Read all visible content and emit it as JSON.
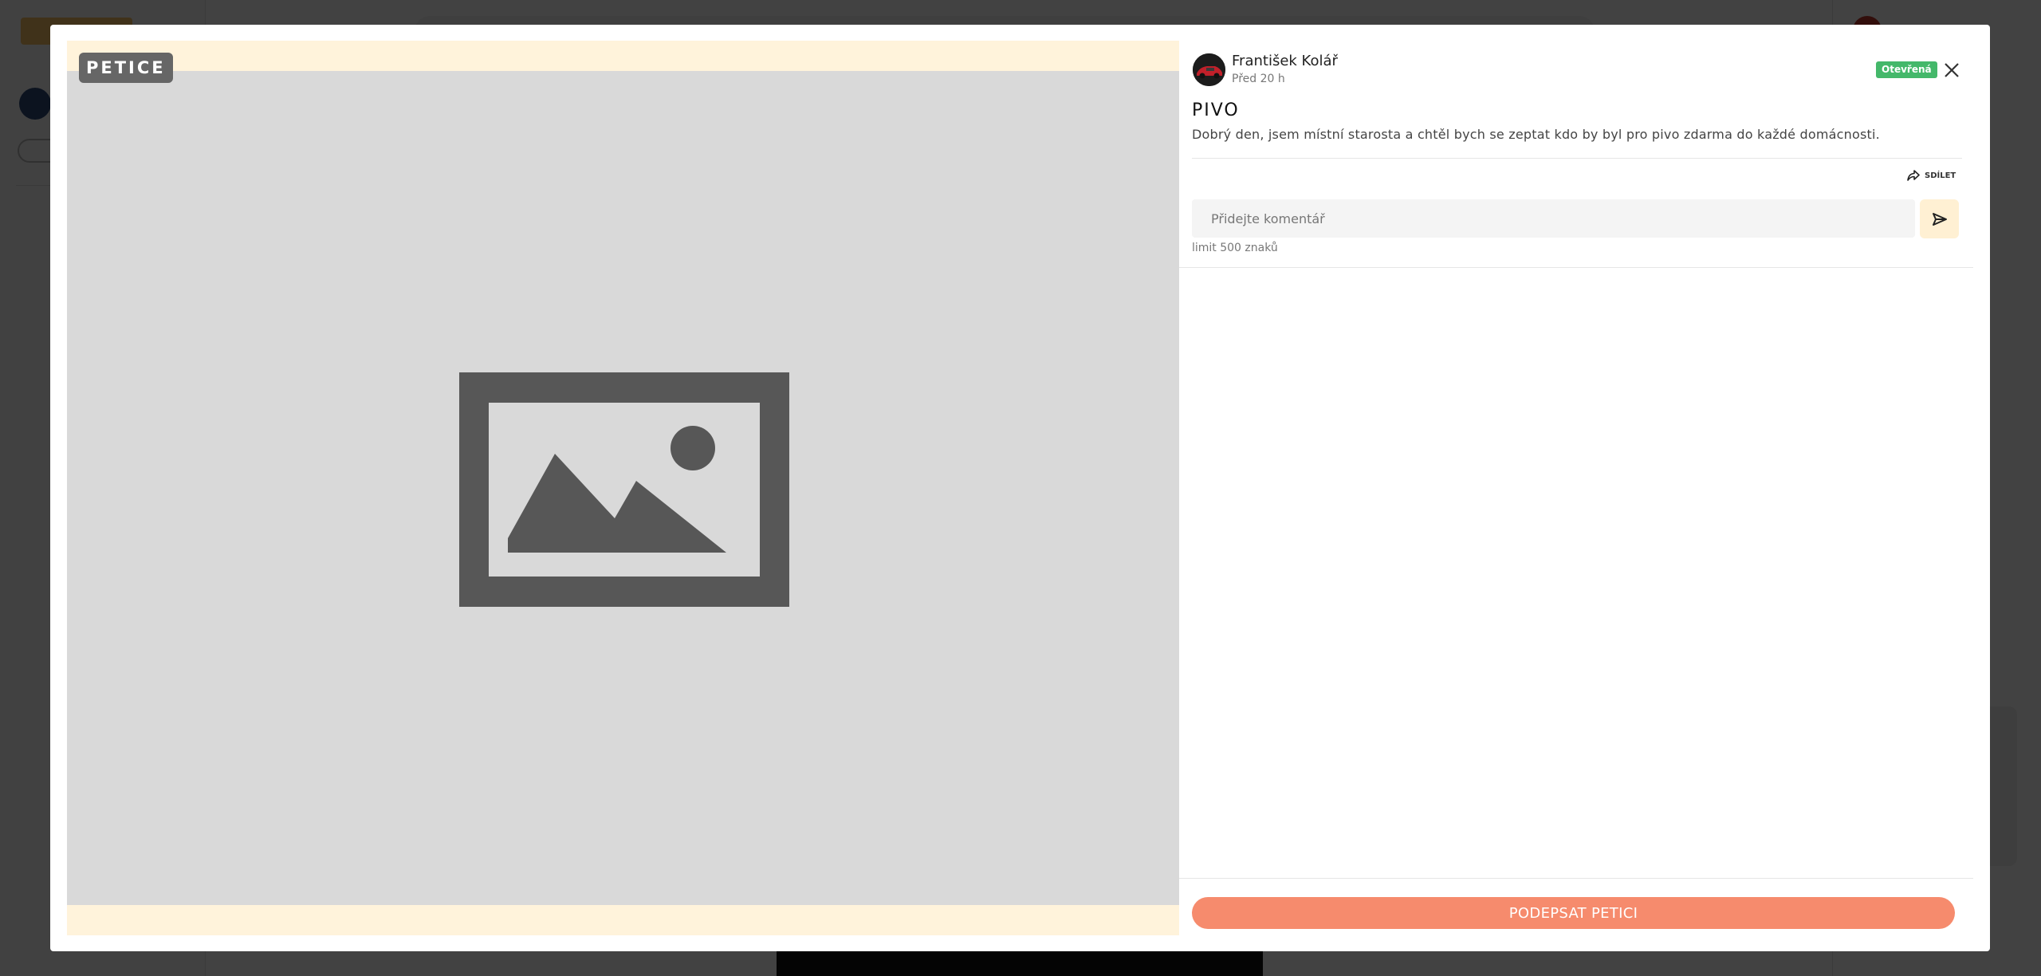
{
  "media": {
    "type_badge": "PETICE",
    "placeholder_icon": "image-placeholder-icon"
  },
  "post": {
    "author": "František Kolář",
    "time": "Před 20 h",
    "status": "Otevřená",
    "title": "PIVO",
    "body": "Dobrý den, jsem místní starosta a chtěl bych se zeptat kdo by byl pro pivo zdarma do každé domácnosti."
  },
  "actions": {
    "share_label": "SDÍLET",
    "close_icon": "close-icon"
  },
  "comment": {
    "placeholder": "Přidejte komentář",
    "limit": "limit 500 znaků"
  },
  "footer": {
    "sign_label": "PODEPSAT PETICI"
  },
  "colors": {
    "status_green": "#44b86a",
    "sign_button": "#f68b6d",
    "media_frame": "#fff3db",
    "send_button": "#fff0d3"
  }
}
